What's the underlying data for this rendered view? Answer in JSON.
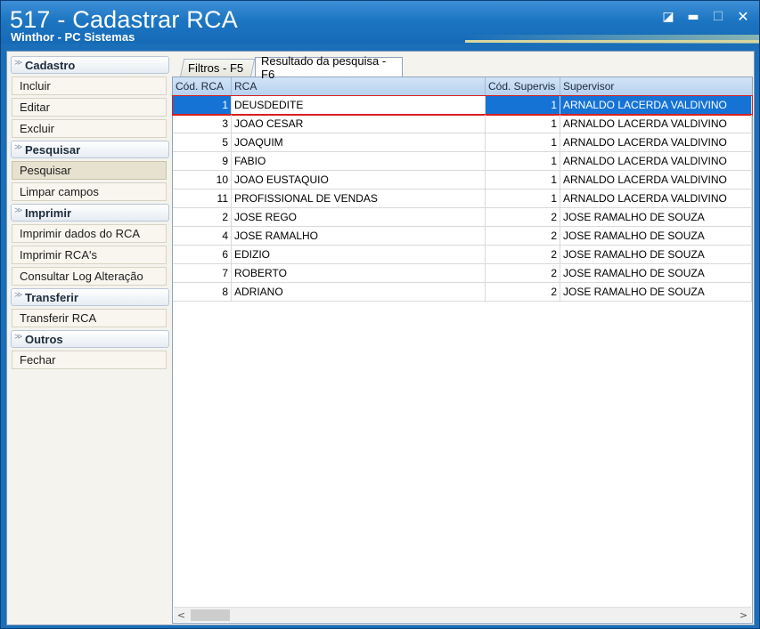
{
  "window": {
    "title": "517 - Cadastrar RCA",
    "subtitle": "Winthor - PC Sistemas",
    "controls": {
      "restore": "◪",
      "minimize": "▬",
      "maximize": "☐",
      "close": "✕"
    }
  },
  "sidebar": {
    "groups": [
      {
        "label": "Cadastro",
        "items": [
          "Incluir",
          "Editar",
          "Excluir"
        ]
      },
      {
        "label": "Pesquisar",
        "items": [
          "Pesquisar",
          "Limpar campos"
        ]
      },
      {
        "label": "Imprimir",
        "items": [
          "Imprimir dados do RCA",
          "Imprimir RCA's",
          "Consultar Log Alteração"
        ]
      },
      {
        "label": "Transferir",
        "items": [
          "Transferir RCA"
        ]
      },
      {
        "label": "Outros",
        "items": [
          "Fechar"
        ]
      }
    ],
    "active_item": "Pesquisar",
    "chevron": "≫"
  },
  "tabs": [
    {
      "label": "Filtros - F5"
    },
    {
      "label": "Resultado da pesquisa - F6",
      "active": true
    }
  ],
  "grid": {
    "columns": [
      "Cód. RCA",
      "RCA",
      "Cód. Supervis",
      "Supervisor"
    ],
    "rows": [
      {
        "cod": "1",
        "rca": "DEUSDEDITE",
        "cod_sup": "1",
        "supervisor": "ARNALDO LACERDA VALDIVINO"
      },
      {
        "cod": "3",
        "rca": "JOAO CESAR",
        "cod_sup": "1",
        "supervisor": "ARNALDO LACERDA VALDIVINO"
      },
      {
        "cod": "5",
        "rca": "JOAQUIM",
        "cod_sup": "1",
        "supervisor": "ARNALDO LACERDA VALDIVINO"
      },
      {
        "cod": "9",
        "rca": "FABIO",
        "cod_sup": "1",
        "supervisor": "ARNALDO LACERDA VALDIVINO"
      },
      {
        "cod": "10",
        "rca": "JOAO EUSTAQUIO",
        "cod_sup": "1",
        "supervisor": "ARNALDO LACERDA VALDIVINO"
      },
      {
        "cod": "11",
        "rca": "PROFISSIONAL DE VENDAS",
        "cod_sup": "1",
        "supervisor": "ARNALDO LACERDA VALDIVINO"
      },
      {
        "cod": "2",
        "rca": "JOSE REGO",
        "cod_sup": "2",
        "supervisor": "JOSE RAMALHO DE SOUZA"
      },
      {
        "cod": "4",
        "rca": "JOSE RAMALHO",
        "cod_sup": "2",
        "supervisor": "JOSE RAMALHO DE SOUZA"
      },
      {
        "cod": "6",
        "rca": "EDIZIO",
        "cod_sup": "2",
        "supervisor": "JOSE RAMALHO DE SOUZA"
      },
      {
        "cod": "7",
        "rca": "ROBERTO",
        "cod_sup": "2",
        "supervisor": "JOSE RAMALHO DE SOUZA"
      },
      {
        "cod": "8",
        "rca": "ADRIANO",
        "cod_sup": "2",
        "supervisor": "JOSE RAMALHO DE SOUZA"
      }
    ],
    "selected_row": 0
  },
  "scrollbar": {
    "left": "<",
    "right": ">"
  },
  "colors": {
    "titlebar": "#1d76c2",
    "selection": "#1673d6",
    "highlight_border": "#d6201e"
  }
}
